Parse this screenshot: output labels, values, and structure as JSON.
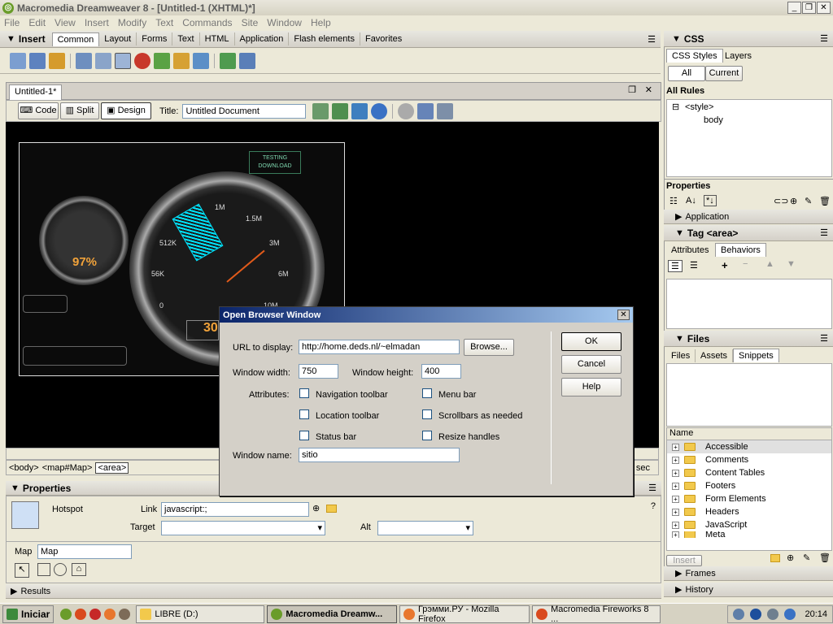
{
  "window": {
    "title": "Macromedia Dreamweaver 8 - [Untitled-1 (XHTML)*]"
  },
  "menu": [
    "File",
    "Edit",
    "View",
    "Insert",
    "Modify",
    "Text",
    "Commands",
    "Site",
    "Window",
    "Help"
  ],
  "insert_bar": {
    "title": "Insert",
    "tabs": [
      "Common",
      "Layout",
      "Forms",
      "Text",
      "HTML",
      "Application",
      "Flash elements",
      "Favorites"
    ]
  },
  "document": {
    "tab": "Untitled-1*",
    "view_buttons": [
      "Code",
      "Split",
      "Design"
    ],
    "title_label": "Title:",
    "title_value": "Untitled Document",
    "tag_selector": [
      "<body>",
      "<map#Map>",
      "<area>"
    ],
    "status_right": "sec"
  },
  "canvas": {
    "testing_label": "TESTING\nDOWNLOAD",
    "gauge_small": "97%",
    "gauge_big_labels": [
      "1M",
      "1.5M",
      "512K",
      "3M",
      "56K",
      "6M",
      "0",
      "10M"
    ],
    "readout": "30"
  },
  "dialog": {
    "title": "Open Browser Window",
    "url_label": "URL to display:",
    "url_value": "http://home.deds.nl/~elmadan",
    "browse": "Browse...",
    "width_label": "Window width:",
    "width_value": "750",
    "height_label": "Window height:",
    "height_value": "400",
    "attributes_label": "Attributes:",
    "attrs": [
      "Navigation toolbar",
      "Menu bar",
      "Location toolbar",
      "Scrollbars as needed",
      "Status bar",
      "Resize handles"
    ],
    "name_label": "Window name:",
    "name_value": "sitio",
    "ok": "OK",
    "cancel": "Cancel",
    "help": "Help"
  },
  "properties": {
    "title": "Properties",
    "hotspot": "Hotspot",
    "link_label": "Link",
    "link_value": "javascript:;",
    "target_label": "Target",
    "alt_label": "Alt",
    "map_label": "Map",
    "map_value": "Map",
    "results": "Results"
  },
  "css_panel": {
    "title": "CSS",
    "tabs": [
      "CSS Styles",
      "Layers"
    ],
    "mode": [
      "All",
      "Current"
    ],
    "all_rules": "All Rules",
    "tree": [
      "<style>",
      "body"
    ],
    "props_title": "Properties"
  },
  "app_panel": {
    "title": "Application"
  },
  "tag_panel": {
    "title": "Tag <area>",
    "tabs": [
      "Attributes",
      "Behaviors"
    ]
  },
  "files_panel": {
    "title": "Files",
    "tabs": [
      "Files",
      "Assets",
      "Snippets"
    ],
    "col_name": "Name",
    "items": [
      "Accessible",
      "Comments",
      "Content Tables",
      "Footers",
      "Form Elements",
      "Headers",
      "JavaScript",
      "Meta"
    ],
    "insert": "Insert"
  },
  "collapsed_panels": [
    "Frames",
    "History"
  ],
  "taskbar": {
    "start": "Iniciar",
    "items": [
      "LIBRE (D:)",
      "Macromedia Dreamw...",
      "Грэмми.РУ - Mozilla Firefox",
      "Macromedia Fireworks 8 ..."
    ],
    "clock": "20:14"
  },
  "colors": {
    "accent": "#316ac5",
    "dialog_title": "#0a246a",
    "canvas_bg": "#000000",
    "hotspot": "#00e5ff"
  }
}
